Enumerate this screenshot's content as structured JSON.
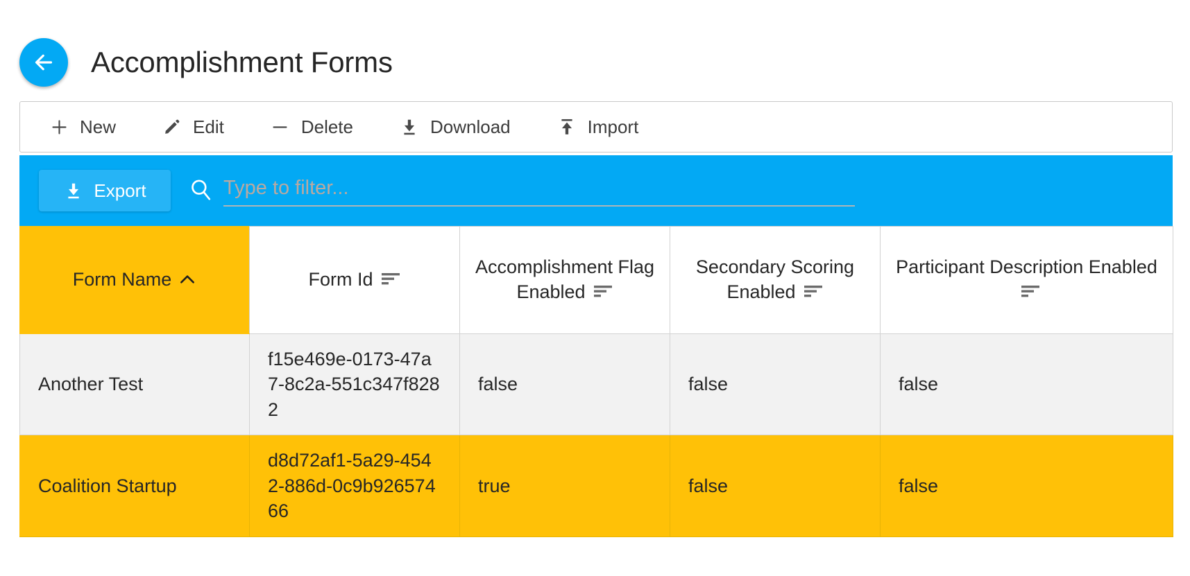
{
  "header": {
    "back_icon": "arrow-left-icon",
    "title": "Accomplishment Forms",
    "accent_blue": "#03A9F4"
  },
  "toolbar": {
    "items": [
      {
        "label": "New",
        "icon": "plus-icon"
      },
      {
        "label": "Edit",
        "icon": "pencil-icon"
      },
      {
        "label": "Delete",
        "icon": "minus-icon"
      },
      {
        "label": "Download",
        "icon": "download-icon"
      },
      {
        "label": "Import",
        "icon": "upload-icon"
      }
    ]
  },
  "filter_bar": {
    "export_label": "Export",
    "export_icon": "download-icon",
    "search_icon": "search-icon",
    "filter_placeholder": "Type to filter...",
    "filter_value": "",
    "background": "#03A9F4",
    "export_background": "#26B4F6"
  },
  "grid": {
    "selected_row_color": "#FFC107",
    "sorted_header_color": "#FFC107",
    "columns": [
      {
        "label": "Form Name",
        "icon": "chevron-up-icon",
        "sorted": true
      },
      {
        "label": "Form Id",
        "icon": "filter-lines-icon",
        "sorted": false
      },
      {
        "label": "Accomplishment Flag Enabled",
        "icon": "filter-lines-icon",
        "sorted": false
      },
      {
        "label": "Secondary Scoring Enabled",
        "icon": "filter-lines-icon",
        "sorted": false
      },
      {
        "label": "Participant Description Enabled",
        "icon": "filter-lines-icon",
        "sorted": false
      }
    ],
    "rows": [
      {
        "selected": false,
        "form_name": "Another Test",
        "form_id": "f15e469e-0173-47a7-8c2a-551c347f8282",
        "accomplishment_flag_enabled": "false",
        "secondary_scoring_enabled": "false",
        "participant_description_enabled": "false"
      },
      {
        "selected": true,
        "form_name": "Coalition Startup",
        "form_id": "d8d72af1-5a29-4542-886d-0c9b92657466",
        "accomplishment_flag_enabled": "true",
        "secondary_scoring_enabled": "false",
        "participant_description_enabled": "false"
      }
    ]
  }
}
